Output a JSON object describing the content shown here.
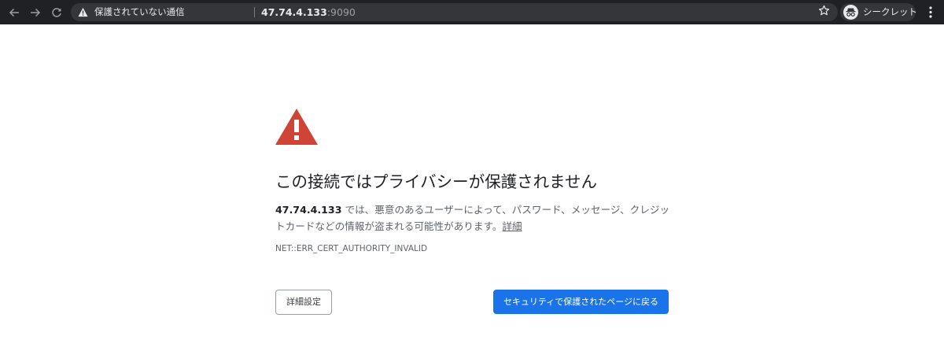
{
  "browser": {
    "security_status": "保護されていない通信",
    "url_host": "47.74.4.133",
    "url_port": ":9090",
    "incognito_label": "シークレット",
    "icons": [
      "back-arrow-icon",
      "forward-arrow-icon",
      "reload-icon",
      "warning-triangle-icon",
      "star-icon",
      "incognito-icon",
      "more-vert-icon"
    ]
  },
  "page": {
    "heading": "この接続ではプライバシーが保護されません",
    "host_bold": "47.74.4.133",
    "message": " では、悪意のあるユーザーによって、パスワード、メッセージ、クレジットカードなどの情報が盗まれる可能性があります。",
    "details_link": "詳細",
    "error_code": "NET::ERR_CERT_AUTHORITY_INVALID",
    "advanced_button": "詳細設定",
    "back_button": "セキュリティで保護されたページに戻る"
  },
  "colors": {
    "topbar_bg": "#202124",
    "omnibox_bg": "#35363a",
    "warning_red": "#d04437",
    "primary_button": "#1a73e8"
  }
}
